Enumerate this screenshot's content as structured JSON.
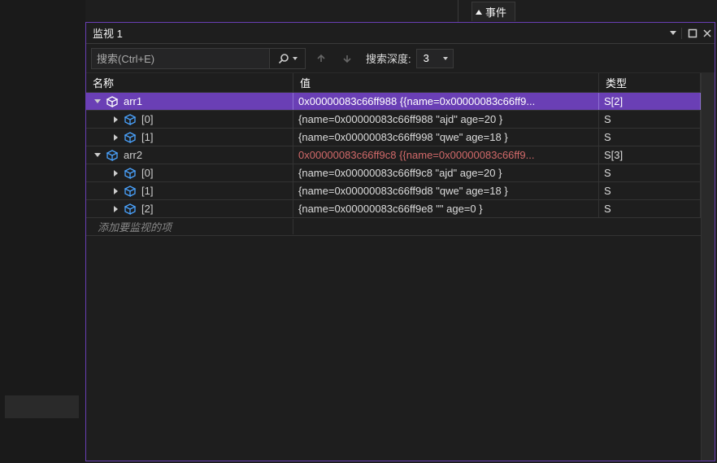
{
  "tabs": {
    "events_label": "事件"
  },
  "panel": {
    "title": "监视 1"
  },
  "toolbar": {
    "search_placeholder": "搜索(Ctrl+E)",
    "depth_label": "搜索深度:",
    "depth_value": "3"
  },
  "headers": {
    "name": "名称",
    "value": "值",
    "type": "类型"
  },
  "rows": [
    {
      "depth": 0,
      "state": "open",
      "name": "arr1",
      "value": "0x00000083c66ff988 {{name=0x00000083c66ff9...",
      "type": "S[2]",
      "selected": true
    },
    {
      "depth": 1,
      "state": "closed",
      "name": "[0]",
      "value": "{name=0x00000083c66ff988 \"ajd\" age=20 }",
      "type": "S"
    },
    {
      "depth": 1,
      "state": "closed",
      "name": "[1]",
      "value": "{name=0x00000083c66ff998 \"qwe\" age=18 }",
      "type": "S"
    },
    {
      "depth": 0,
      "state": "open",
      "name": "arr2",
      "value": "0x00000083c66ff9c8 {{name=0x00000083c66ff9...",
      "type": "S[3]",
      "red": true
    },
    {
      "depth": 1,
      "state": "closed",
      "name": "[0]",
      "value": "{name=0x00000083c66ff9c8 \"ajd\" age=20 }",
      "type": "S"
    },
    {
      "depth": 1,
      "state": "closed",
      "name": "[1]",
      "value": "{name=0x00000083c66ff9d8 \"qwe\" age=18 }",
      "type": "S"
    },
    {
      "depth": 1,
      "state": "closed",
      "name": "[2]",
      "value": "{name=0x00000083c66ff9e8 \"\" age=0 }",
      "type": "S"
    }
  ],
  "add_item_placeholder": "添加要监视的项"
}
